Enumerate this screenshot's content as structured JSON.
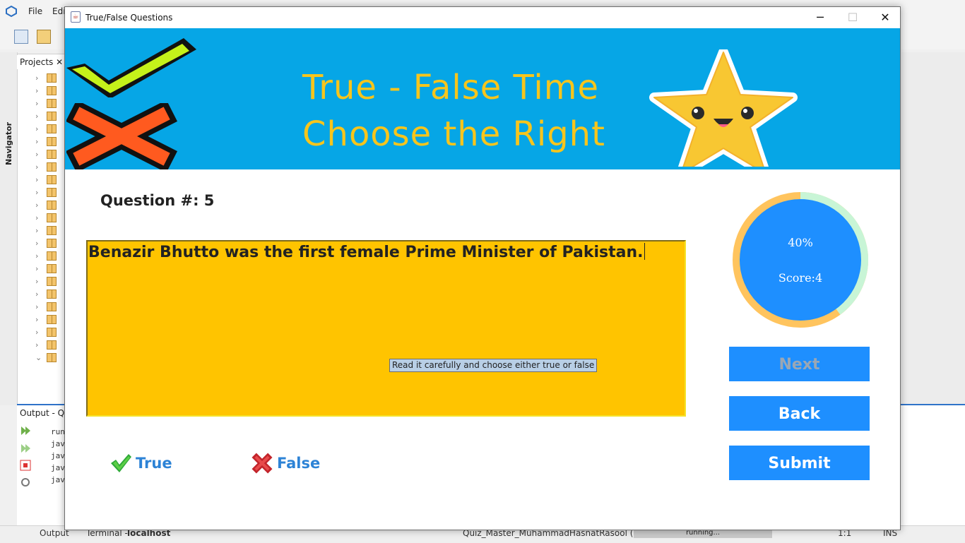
{
  "ide": {
    "menu": [
      "File",
      "Edi"
    ],
    "projects_tab": "Projects",
    "navigator_tab": "Navigator",
    "output_tab": "Output - Qu",
    "output_lines": [
      "run",
      "jav",
      "jav",
      "jav",
      "jav"
    ],
    "status": {
      "output": "Output",
      "terminal": "Terminal -",
      "host": "localhost",
      "project": "Quiz_Master_MuhammadHasnatRasool (run)",
      "progress": "running...",
      "position": "1:1",
      "mode": "INS"
    }
  },
  "dialog": {
    "title": "True/False Questions",
    "minimize_icon": "minimize-icon",
    "maximize_icon": "maximize-icon",
    "close_icon": "close-icon"
  },
  "banner": {
    "line1": "True - False Time",
    "line2": "Choose the Right",
    "title_color": "#f7c51c",
    "background": "#06a6e6"
  },
  "quiz": {
    "question_label": "Question #: 5",
    "question_text": "Benazir Bhutto was the first female Prime Minister of Pakistan.",
    "tooltip": "Read it carefully and choose either true or false",
    "option_true": "True",
    "option_false": "False"
  },
  "progress": {
    "percent_label": "40%",
    "percent_value": 0.4,
    "score_label": "Score:4",
    "fill_color": "#c8f5d6",
    "track_color": "#ffc45e",
    "center_color": "#1e8fff"
  },
  "buttons": {
    "next": "Next",
    "back": "Back",
    "submit": "Submit",
    "accent": "#1e8fff"
  }
}
